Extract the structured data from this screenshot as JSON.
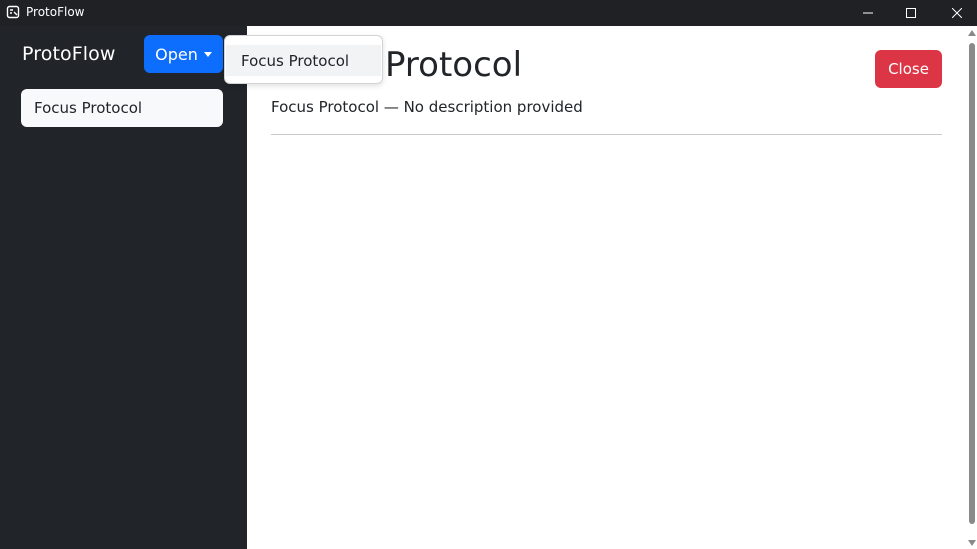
{
  "window": {
    "title": "ProtoFlow",
    "app_icon": "protoflow-app-icon",
    "controls": [
      "minimize-icon",
      "maximize-icon",
      "close-icon"
    ]
  },
  "sidebar": {
    "brand": "ProtoFlow",
    "open_button": {
      "label": "Open"
    },
    "items": [
      {
        "label": "Focus Protocol"
      }
    ]
  },
  "dropdown": {
    "items": [
      {
        "label": "Focus Protocol"
      }
    ]
  },
  "main": {
    "title": "Protocol",
    "description": "Focus Protocol — No description provided",
    "close_button": {
      "label": "Close"
    }
  },
  "colors": {
    "primary": "#0d6efd",
    "danger": "#dc3545",
    "sidebar_bg": "#212529",
    "titlebar_bg": "#202124"
  }
}
